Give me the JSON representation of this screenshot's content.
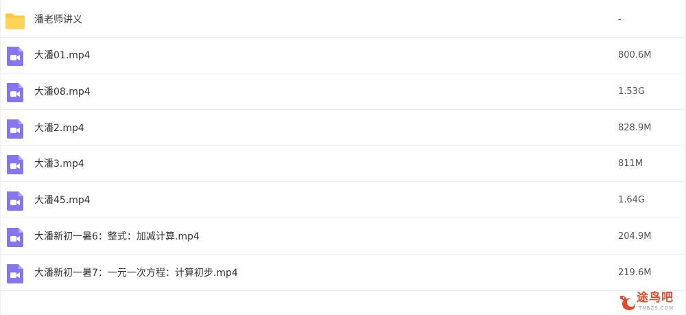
{
  "files": [
    {
      "name": "潘老师讲义",
      "size": "-",
      "type": "folder"
    },
    {
      "name": "大潘01.mp4",
      "size": "800.6M",
      "type": "video"
    },
    {
      "name": "大潘08.mp4",
      "size": "1.53G",
      "type": "video"
    },
    {
      "name": "大潘2.mp4",
      "size": "828.9M",
      "type": "video"
    },
    {
      "name": "大潘3.mp4",
      "size": "811M",
      "type": "video"
    },
    {
      "name": "大潘45.mp4",
      "size": "1.64G",
      "type": "video"
    },
    {
      "name": "大潘新初一暑6：整式：加减计算.mp4",
      "size": "204.9M",
      "type": "video"
    },
    {
      "name": "大潘新初一暑7：一元一次方程：计算初步.mp4",
      "size": "219.6M",
      "type": "video"
    }
  ],
  "watermark": {
    "title": "途鸟吧",
    "subtitle": "TNBZS.COM"
  },
  "colors": {
    "folder": "#fcc940",
    "video": "#8576ee",
    "divider": "#ebeef2",
    "watermark": "#e14a2f"
  },
  "icons": {
    "folder": "folder-icon",
    "video": "video-file-icon"
  }
}
